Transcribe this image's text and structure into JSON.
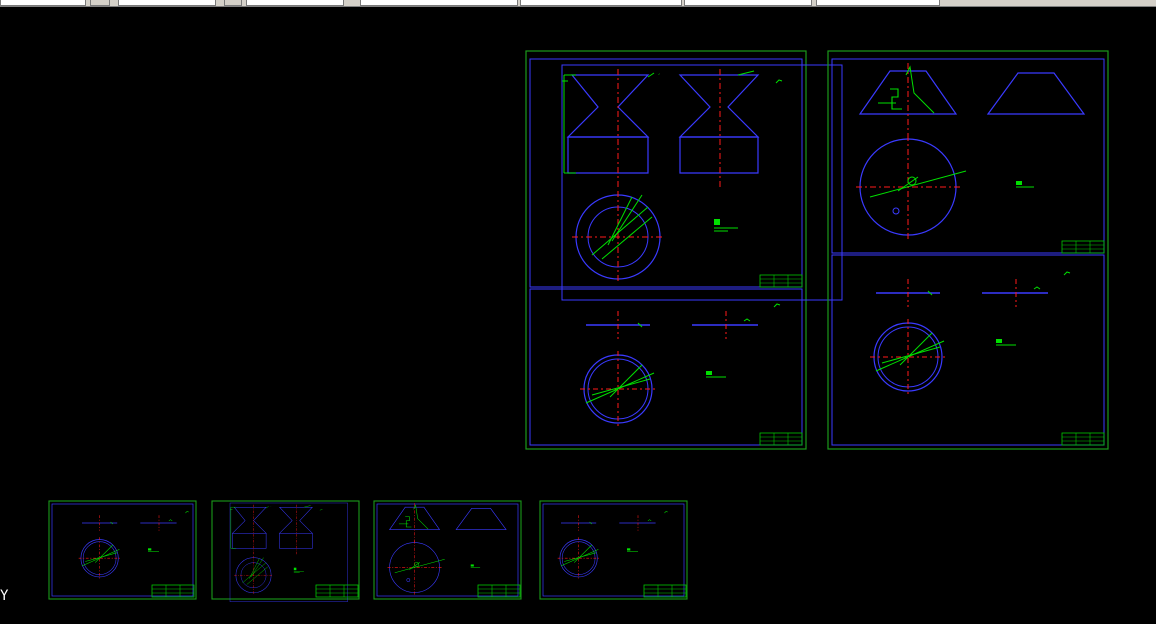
{
  "toolbar": {
    "controls": [
      "layer-control",
      "linetype-control",
      "lineweight-control",
      "plotstyle-control",
      "color-control"
    ]
  },
  "drawing": {
    "background": "#000000",
    "colors": {
      "frame": "#1a9a1a",
      "annotation": "#00e000",
      "geometry": "#3a3aff",
      "centerline": "#ff1a1a",
      "titleblock": "#00c800"
    },
    "sheets": [
      {
        "id": "sheet-large-a",
        "content": [
          "cone-section-elevations",
          "circle-plan"
        ]
      },
      {
        "id": "sheet-large-b",
        "content": [
          "flange-plan"
        ]
      },
      {
        "id": "sheet-large-c",
        "content": [
          "cone-elevation",
          "circle-plan"
        ]
      },
      {
        "id": "sheet-large-d",
        "content": [
          "flange-plan"
        ]
      },
      {
        "id": "sheet-small-1",
        "content": [
          "flange-plan"
        ]
      },
      {
        "id": "sheet-small-2",
        "content": [
          "cone-section-elevations",
          "circle-plan"
        ]
      },
      {
        "id": "sheet-small-3",
        "content": [
          "cone-elevation",
          "circle-plan"
        ]
      },
      {
        "id": "sheet-small-4",
        "content": [
          "flange-plan"
        ]
      }
    ]
  },
  "ucs": {
    "axis_label": "Y"
  }
}
